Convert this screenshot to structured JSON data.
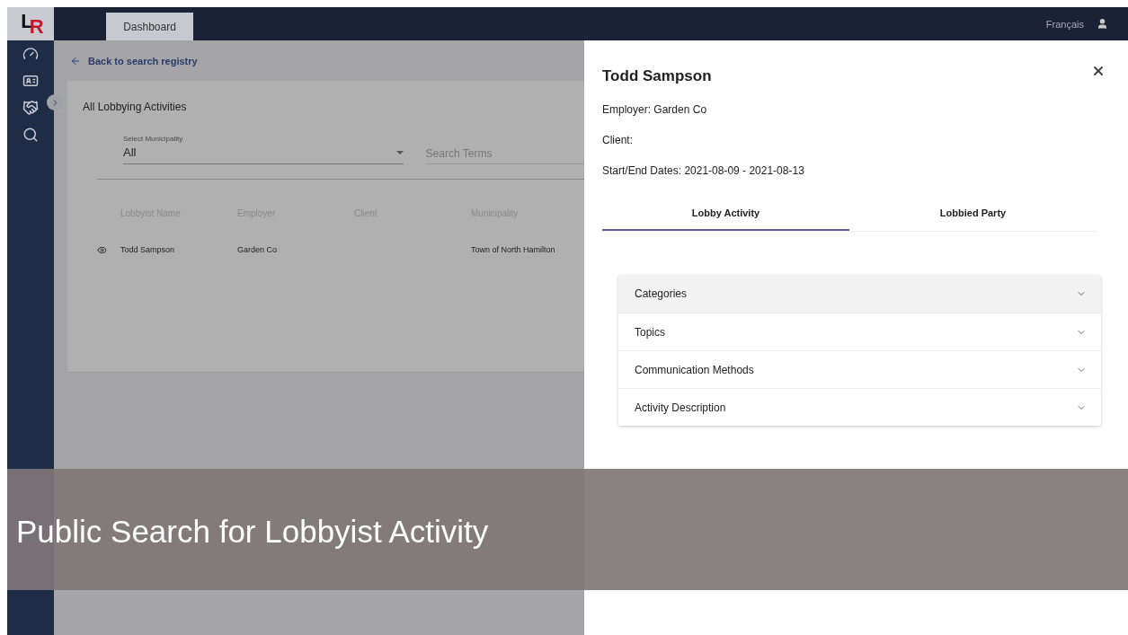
{
  "logo": {
    "letter_1": "L",
    "letter_2": "R"
  },
  "topbar": {
    "tabs": [
      {
        "label": "Dashboard",
        "selected": true
      }
    ],
    "language": "Français"
  },
  "back_link": "Back to search registry",
  "section_title": "All Lobbying Activities",
  "filters": {
    "municipality": {
      "label": "Select Municipality",
      "value": "All"
    },
    "search": {
      "placeholder": "Search Terms"
    }
  },
  "table": {
    "columns": [
      "Lobbyist Name",
      "Employer",
      "Client",
      "Municipality"
    ],
    "rows": [
      {
        "lobbyist_name": "Todd Sampson",
        "employer": "Garden Co",
        "municipality": "Town of North Hamilton"
      }
    ]
  },
  "drawer": {
    "title": "Todd Sampson",
    "details": [
      "Employer: Garden Co",
      "Client:",
      "Start/End Dates: 2021-08-09 - 2021-08-13"
    ],
    "tabs": [
      {
        "label": "Lobby Activity",
        "selected": true
      },
      {
        "label": "Lobbied Party",
        "selected": false
      }
    ],
    "sections": [
      {
        "label": "Categories",
        "expanded": false
      },
      {
        "label": "Topics",
        "expanded": false
      },
      {
        "label": "Communication Methods",
        "expanded": false
      },
      {
        "label": "Activity Description",
        "expanded": false
      }
    ]
  },
  "caption": "Public Search for Lobbyist Activity"
}
